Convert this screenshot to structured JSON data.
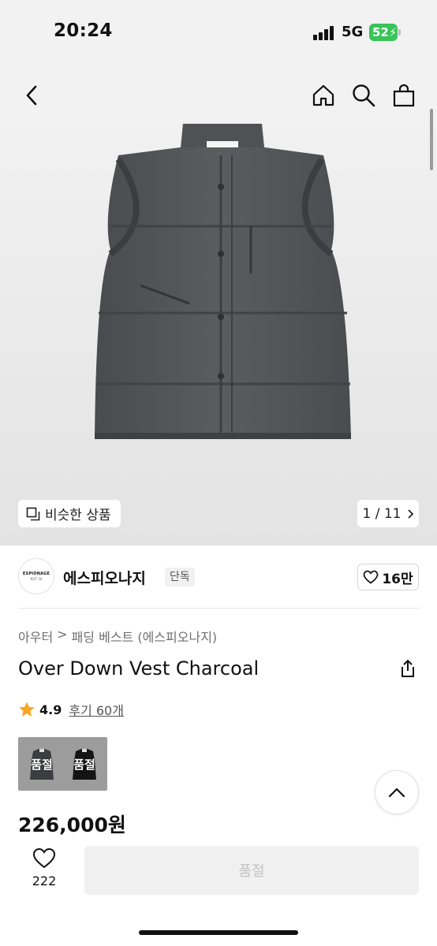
{
  "status": {
    "time": "20:24",
    "network": "5G",
    "battery": "52"
  },
  "nav": {
    "back_icon": "back-chevron-icon",
    "home_icon": "home-icon",
    "search_icon": "search-icon",
    "cart_icon": "shopping-bag-icon"
  },
  "hero": {
    "similar_label": "비슷한 상품",
    "pager": "1 / 11"
  },
  "brand": {
    "logo_line1": "ESPIONAGE",
    "logo_line2": "NOT 50",
    "name": "에스피오나지",
    "badge": "단독",
    "likes": "16만"
  },
  "breadcrumb": {
    "category": "아우터",
    "separator": ">",
    "subcategory": "패딩 베스트 (에스피오나지)"
  },
  "product": {
    "title": "Over Down Vest Charcoal",
    "rating": "4.9",
    "reviews": "후기 60개",
    "price": "226,000원"
  },
  "variants": [
    {
      "label": "품절"
    },
    {
      "label": "품절"
    }
  ],
  "bottom": {
    "wish_count": "222",
    "buy_label": "품절"
  },
  "colors": {
    "star": "#f5a623",
    "battery": "#37c458",
    "vest": "#55565a"
  }
}
